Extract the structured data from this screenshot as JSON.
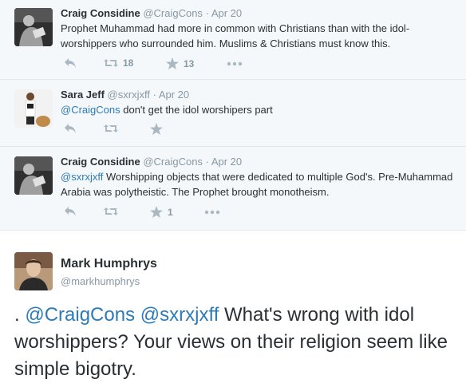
{
  "tweets": [
    {
      "name": "Craig Considine",
      "handle": "@CraigCons",
      "sep": "·",
      "date": "Apr 20",
      "mention": "",
      "text": "Prophet Muhammad had more in common with Christians than with the idol-worshippers who surrounded him. Muslims & Christians must know this.",
      "retweets": "18",
      "favorites": "13",
      "avatar_icon": "silhouette-reading-icon"
    },
    {
      "name": "Sara Jeff",
      "handle": "@sxrxjxff",
      "sep": "·",
      "date": "Apr 20",
      "mention": "@CraigCons",
      "text": " don't get the idol worshipers part",
      "retweets": "",
      "favorites": "",
      "avatar_icon": "woman-photo-icon"
    },
    {
      "name": "Craig Considine",
      "handle": "@CraigCons",
      "sep": "·",
      "date": "Apr 20",
      "mention": "@sxrxjxff",
      "text": " Worshipping objects that were dedicated to multiple God's. Pre-Muhammad Arabia was polytheistic. The Prophet brought monotheism.",
      "retweets": "",
      "favorites": "1",
      "avatar_icon": "silhouette-reading-icon"
    }
  ],
  "reply": {
    "name": "Mark Humphrys",
    "handle": "@markhumphrys",
    "prefix": ". ",
    "mention1": "@CraigCons",
    "mention2": "@sxrxjxff",
    "text": "  What's wrong with idol worshippers? Your views on their religion seem like simple bigotry."
  },
  "colors": {
    "background": "#f5f8fa",
    "link": "#2b7bb9",
    "icon": "#aab8c2",
    "text": "#292f33",
    "muted": "#8899a6"
  }
}
